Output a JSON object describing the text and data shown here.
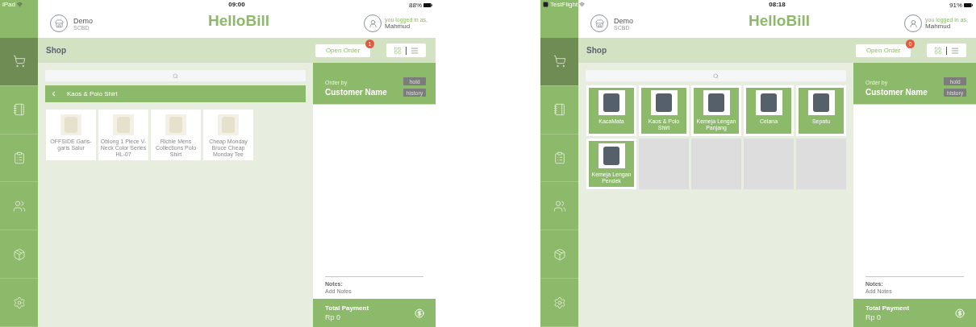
{
  "screens": [
    {
      "status_bar": {
        "carrier": "iPad",
        "time": "09:00",
        "battery": "88%"
      },
      "header": {
        "store_name": "Demo",
        "store_code": "SCBD",
        "brand": "HelloBill",
        "user_caption": "you logged in as,",
        "user_name": "Mahmud"
      },
      "sidebar": {
        "items": [
          {
            "kind": "cart",
            "selected": true
          },
          {
            "kind": "notebook",
            "selected": false
          },
          {
            "kind": "report",
            "selected": false
          },
          {
            "kind": "people",
            "selected": false
          },
          {
            "kind": "trolley",
            "selected": false
          },
          {
            "kind": "settings",
            "selected": false
          }
        ]
      },
      "toolbar": {
        "title": "Shop",
        "open_order": "Open Order",
        "badge": "1",
        "view_modes": [
          {
            "kind": "grid",
            "selected": true
          },
          {
            "kind": "list",
            "selected": false
          }
        ]
      },
      "catalog": {
        "breadcrumb": "Kaos & Polo Shirt",
        "products": [
          {
            "kind": "item",
            "name": "OFFSIDE Garis-garis Salur"
          },
          {
            "kind": "item",
            "name": "Oblong 1 Piece V-Neck Color Series HL-07"
          },
          {
            "kind": "item",
            "name": "Richie Mens Collections Polo Shirt"
          },
          {
            "kind": "item",
            "name": "Cheap Monday Bruce Cheap Monday Tee"
          }
        ]
      },
      "order": {
        "caption": "Order by",
        "customer": "Customer Name",
        "buttons": [
          "hold",
          "history"
        ],
        "notes_label": "Notes:",
        "notes_placeholder": "Add Notes",
        "total_label": "Total Payment",
        "total": "Rp 0"
      }
    },
    {
      "status_bar": {
        "carrier": "TestFlight",
        "time": "08:18",
        "battery": "91%"
      },
      "header": {
        "store_name": "Demo",
        "store_code": "SCBD",
        "brand": "HelloBill",
        "user_caption": "you logged in as,",
        "user_name": "Mahmud"
      },
      "sidebar": {
        "items": [
          {
            "kind": "cart",
            "selected": true
          },
          {
            "kind": "notebook",
            "selected": false
          },
          {
            "kind": "report",
            "selected": false
          },
          {
            "kind": "people",
            "selected": false
          },
          {
            "kind": "trolley",
            "selected": false
          },
          {
            "kind": "settings",
            "selected": false
          }
        ]
      },
      "toolbar": {
        "title": "Shop",
        "open_order": "Open Order",
        "badge": "0",
        "view_modes": [
          {
            "kind": "grid",
            "selected": true
          },
          {
            "kind": "list",
            "selected": false
          }
        ]
      },
      "catalog": {
        "products": [
          {
            "kind": "category",
            "name": "KacaMata"
          },
          {
            "kind": "category",
            "name": "Kaos & Polo Shirt"
          },
          {
            "kind": "category",
            "name": "Kemeja Lengan Panjang"
          },
          {
            "kind": "category",
            "name": "Celana"
          },
          {
            "kind": "category",
            "name": "Sepatu"
          },
          {
            "kind": "category",
            "name": "Kemeja Lengan Pendek"
          },
          {
            "kind": "empty"
          },
          {
            "kind": "empty"
          },
          {
            "kind": "empty"
          },
          {
            "kind": "empty"
          }
        ]
      },
      "order": {
        "caption": "Order by",
        "customer": "Customer Name",
        "buttons": [
          "hold",
          "history"
        ],
        "notes_label": "Notes:",
        "notes_placeholder": "Add Notes",
        "total_label": "Total Payment",
        "total": "Rp 0"
      }
    }
  ]
}
